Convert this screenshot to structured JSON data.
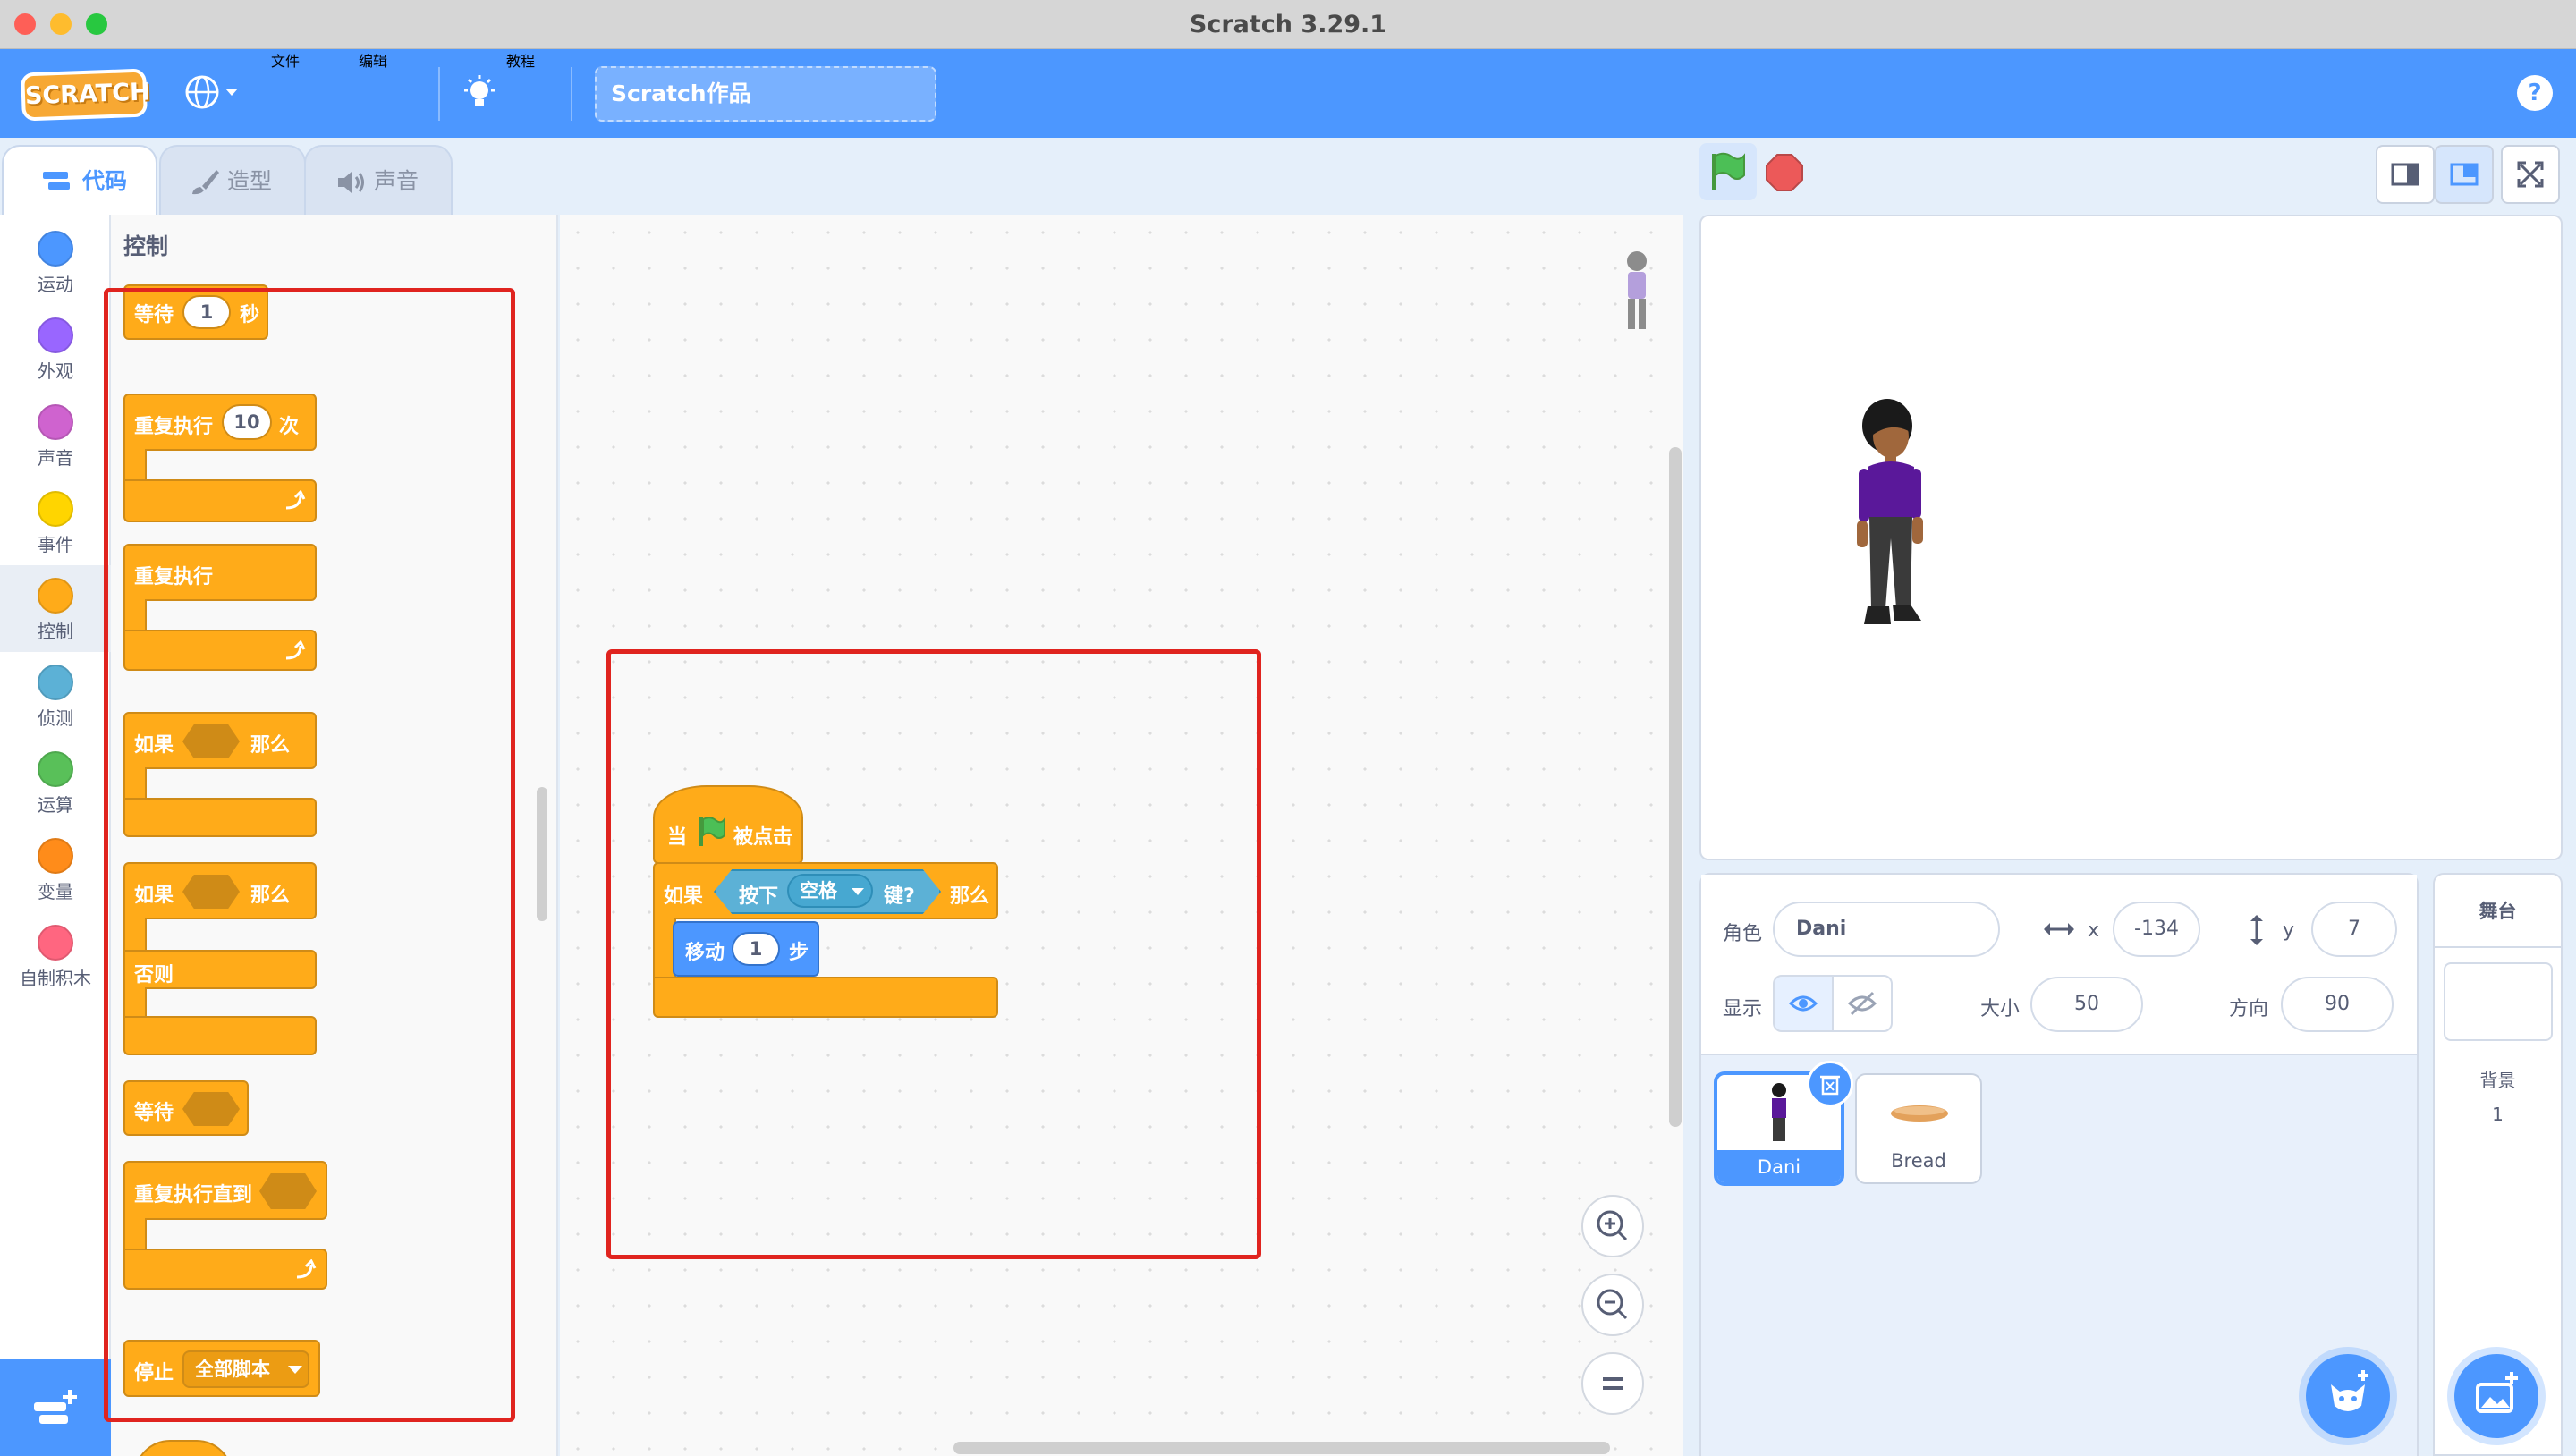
{
  "window": {
    "title": "Scratch 3.29.1"
  },
  "menu": {
    "logo_text": "SCRATCH",
    "file": "文件",
    "edit": "编辑",
    "tutorials": "教程",
    "project_title": "Scratch作品",
    "help": "?"
  },
  "tabs": {
    "code": "代码",
    "costumes": "造型",
    "sounds": "声音"
  },
  "categories": [
    {
      "label": "运动",
      "color": "#4c97ff"
    },
    {
      "label": "外观",
      "color": "#9966ff"
    },
    {
      "label": "声音",
      "color": "#cf63cf"
    },
    {
      "label": "事件",
      "color": "#ffd500"
    },
    {
      "label": "控制",
      "color": "#ffab19"
    },
    {
      "label": "侦测",
      "color": "#5cb1d6"
    },
    {
      "label": "运算",
      "color": "#59c059"
    },
    {
      "label": "变量",
      "color": "#ff8c1a"
    },
    {
      "label": "自制积木",
      "color": "#ff6680"
    }
  ],
  "palette": {
    "title": "控制",
    "wait": {
      "label": "等待",
      "value": "1",
      "unit": "秒"
    },
    "repeat": {
      "label": "重复执行",
      "value": "10",
      "unit": "次"
    },
    "forever": {
      "label": "重复执行"
    },
    "if_then": {
      "if": "如果",
      "then": "那么"
    },
    "if_else": {
      "if": "如果",
      "then": "那么",
      "else": "否则"
    },
    "wait_until": {
      "label": "等待"
    },
    "repeat_until": {
      "label": "重复执行直到"
    },
    "stop": {
      "label": "停止",
      "option": "全部脚本"
    }
  },
  "script": {
    "hat": {
      "when": "当",
      "clicked": "被点击"
    },
    "if": {
      "if": "如果",
      "key_pressed": "按下",
      "key": "空格",
      "key_suffix": "键?",
      "then": "那么"
    },
    "move": {
      "label": "移动",
      "value": "1",
      "unit": "步"
    }
  },
  "sprite_info": {
    "sprite_label": "角色",
    "sprite_name": "Dani",
    "x_label": "x",
    "x": "-134",
    "y_label": "y",
    "y": "7",
    "show_label": "显示",
    "size_label": "大小",
    "size": "50",
    "direction_label": "方向",
    "direction": "90"
  },
  "sprites": [
    {
      "name": "Dani",
      "selected": true
    },
    {
      "name": "Bread",
      "selected": false
    }
  ],
  "stage_panel": {
    "title": "舞台",
    "backdrops_label": "背景",
    "backdrops_count": "1"
  },
  "colors": {
    "menubar": "#4c97ff",
    "control": "#ffab19",
    "motion": "#4c97ff",
    "sensing": "#5cb1d6",
    "flag": "#4cbf56",
    "stop": "#ec5959",
    "annotation": "#e0241f"
  }
}
